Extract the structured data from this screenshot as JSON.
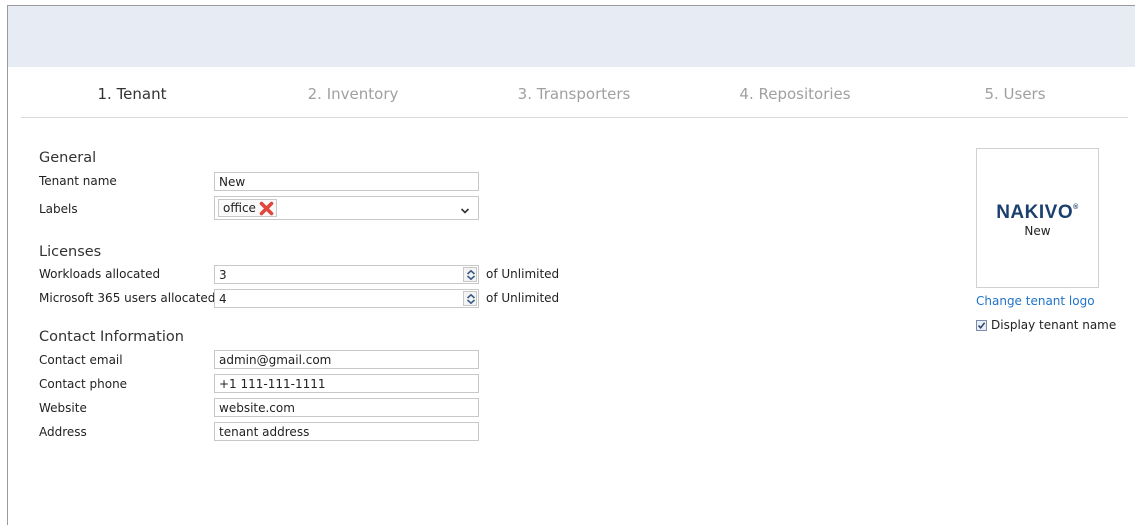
{
  "wizard": {
    "steps": [
      {
        "label": "1. Tenant",
        "active": true
      },
      {
        "label": "2. Inventory",
        "active": false
      },
      {
        "label": "3. Transporters",
        "active": false
      },
      {
        "label": "4. Repositories",
        "active": false
      },
      {
        "label": "5. Users",
        "active": false
      }
    ]
  },
  "general": {
    "title": "General",
    "tenant_name_label": "Tenant name",
    "tenant_name_value": "New",
    "labels_label": "Labels",
    "labels_chips": [
      "office"
    ]
  },
  "licenses": {
    "title": "Licenses",
    "workloads_label": "Workloads allocated",
    "workloads_value": "3",
    "workloads_suffix": "of Unlimited",
    "m365_label": "Microsoft 365 users allocated",
    "m365_value": "4",
    "m365_suffix": "of Unlimited"
  },
  "contact": {
    "title": "Contact Information",
    "email_label": "Contact email",
    "email_value": "admin@gmail.com",
    "phone_label": "Contact phone",
    "phone_value": "+1 111-111-1111",
    "website_label": "Website",
    "website_value": "website.com",
    "address_label": "Address",
    "address_value": "tenant address"
  },
  "logo": {
    "brand": "NAKIVO",
    "brand_mark": "®",
    "tenant_name": "New",
    "change_link": "Change tenant logo",
    "display_name_label": "Display tenant name",
    "display_name_checked": true
  },
  "colors": {
    "topbar": "#e6ebf4",
    "link": "#1f73c9",
    "brand": "#1b3f6e",
    "remove_x": "#e0463c"
  }
}
